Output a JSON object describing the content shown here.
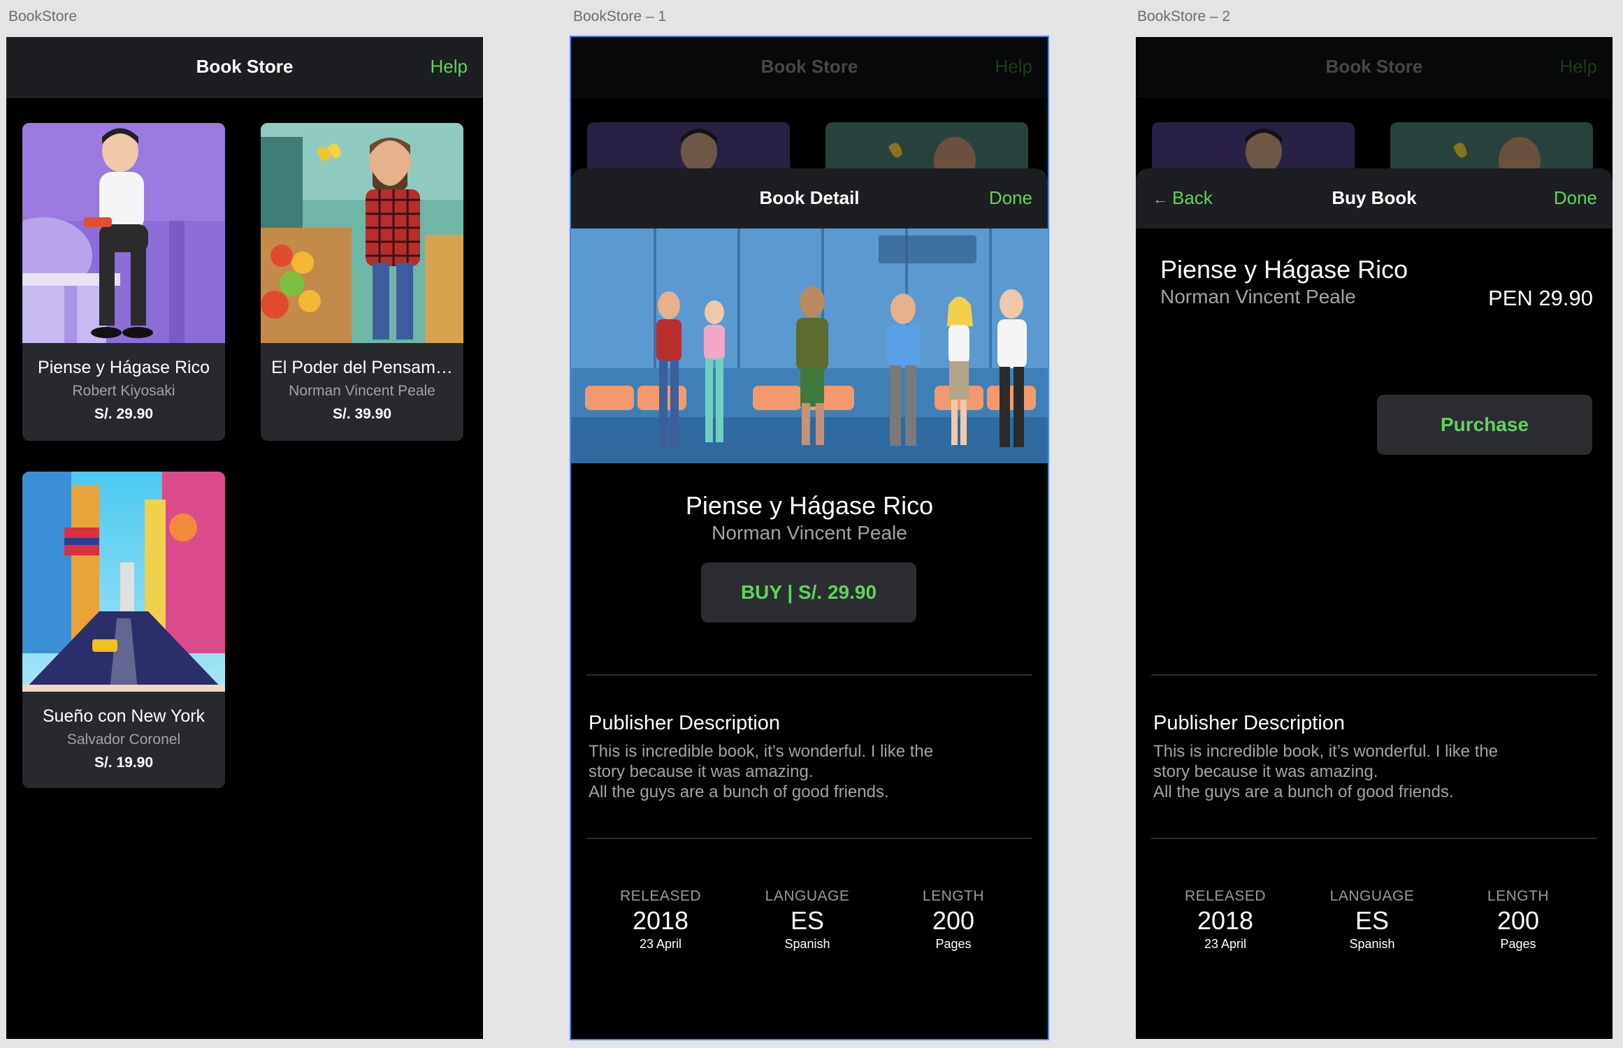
{
  "artboards": [
    {
      "label": "BookStore"
    },
    {
      "label": "BookStore – 1"
    },
    {
      "label": "BookStore – 2"
    }
  ],
  "store_nav": {
    "title": "Book Store",
    "help": "Help"
  },
  "books": [
    {
      "title": "Piense y Hágase Rico",
      "author": "Robert Kiyosaki",
      "price": "S/. 29.90"
    },
    {
      "title": "El Poder del Pensam…",
      "author": "Norman Vincent Peale",
      "price": "S/. 39.90"
    },
    {
      "title": "Sueño con New York",
      "author": "Salvador Coronel",
      "price": "S/. 19.90"
    }
  ],
  "detail": {
    "nav_title": "Book Detail",
    "done": "Done",
    "book_title": "Piense y Hágase Rico",
    "author": "Norman Vincent Peale",
    "buy_label": "BUY | S/. 29.90",
    "section_title": "Publisher Description",
    "description": [
      "This is incredible book, it’s wonderful. I like the",
      "story because it was amazing.",
      "All the guys are a bunch of good friends."
    ],
    "stats": [
      {
        "label": "RELEASED",
        "value": "2018",
        "sub": "23 April"
      },
      {
        "label": "LANGUAGE",
        "value": "ES",
        "sub": "Spanish"
      },
      {
        "label": "LENGTH",
        "value": "200",
        "sub": "Pages"
      }
    ]
  },
  "buy": {
    "back": "Back",
    "nav_title": "Buy Book",
    "done": "Done",
    "book_title": "Piense y Hágase Rico",
    "author": "Norman Vincent Peale",
    "price": "PEN 29.90",
    "purchase": "Purchase"
  },
  "colors": {
    "accent": "#5fd35f",
    "background": "#000000",
    "card": "#27292d",
    "navbar": "#1c1e21",
    "selection": "#4a86e8"
  }
}
